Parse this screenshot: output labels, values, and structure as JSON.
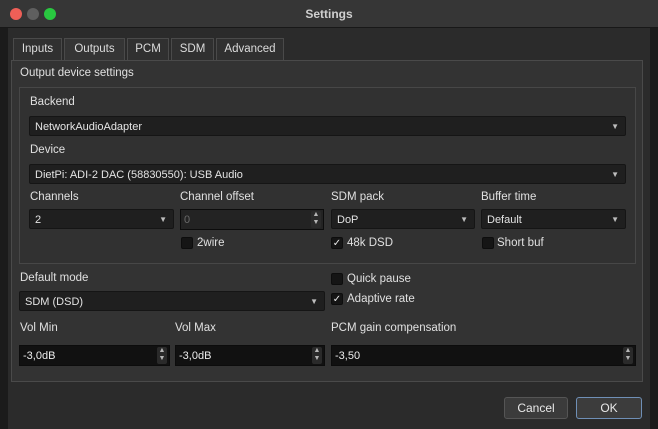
{
  "window": {
    "title": "Settings"
  },
  "tabs": [
    {
      "label": "Inputs"
    },
    {
      "label": "Outputs",
      "active": true
    },
    {
      "label": "PCM"
    },
    {
      "label": "SDM"
    },
    {
      "label": "Advanced"
    }
  ],
  "output": {
    "section_title": "Output device settings",
    "backend": {
      "label": "Backend",
      "value": "NetworkAudioAdapter"
    },
    "device": {
      "label": "Device",
      "value": "DietPi: ADI-2 DAC (58830550): USB Audio"
    },
    "channels": {
      "label": "Channels",
      "value": "2"
    },
    "channel_offset": {
      "label": "Channel offset",
      "value": "0"
    },
    "sdm_pack": {
      "label": "SDM pack",
      "value": "DoP"
    },
    "buffer_time": {
      "label": "Buffer time",
      "value": "Default"
    },
    "twowire": {
      "label": "2wire",
      "checked": false
    },
    "dsd48k": {
      "label": "48k DSD",
      "checked": true
    },
    "short_buf": {
      "label": "Short buf",
      "checked": false
    }
  },
  "default_mode": {
    "label": "Default mode",
    "value": "SDM (DSD)"
  },
  "quick_pause": {
    "label": "Quick pause",
    "checked": false
  },
  "adaptive_rate": {
    "label": "Adaptive rate",
    "checked": true
  },
  "vol_min": {
    "label": "Vol Min",
    "value": "-3,0dB"
  },
  "vol_max": {
    "label": "Vol Max",
    "value": "-3,0dB"
  },
  "pcm_gain": {
    "label": "PCM gain compensation",
    "value": "-3,50"
  },
  "buttons": {
    "cancel": "Cancel",
    "ok": "OK"
  },
  "check_glyph": "✓",
  "colors": {
    "close": "#ee5f57",
    "maximize": "#29c840",
    "ok_border": "#6f8fb6"
  }
}
